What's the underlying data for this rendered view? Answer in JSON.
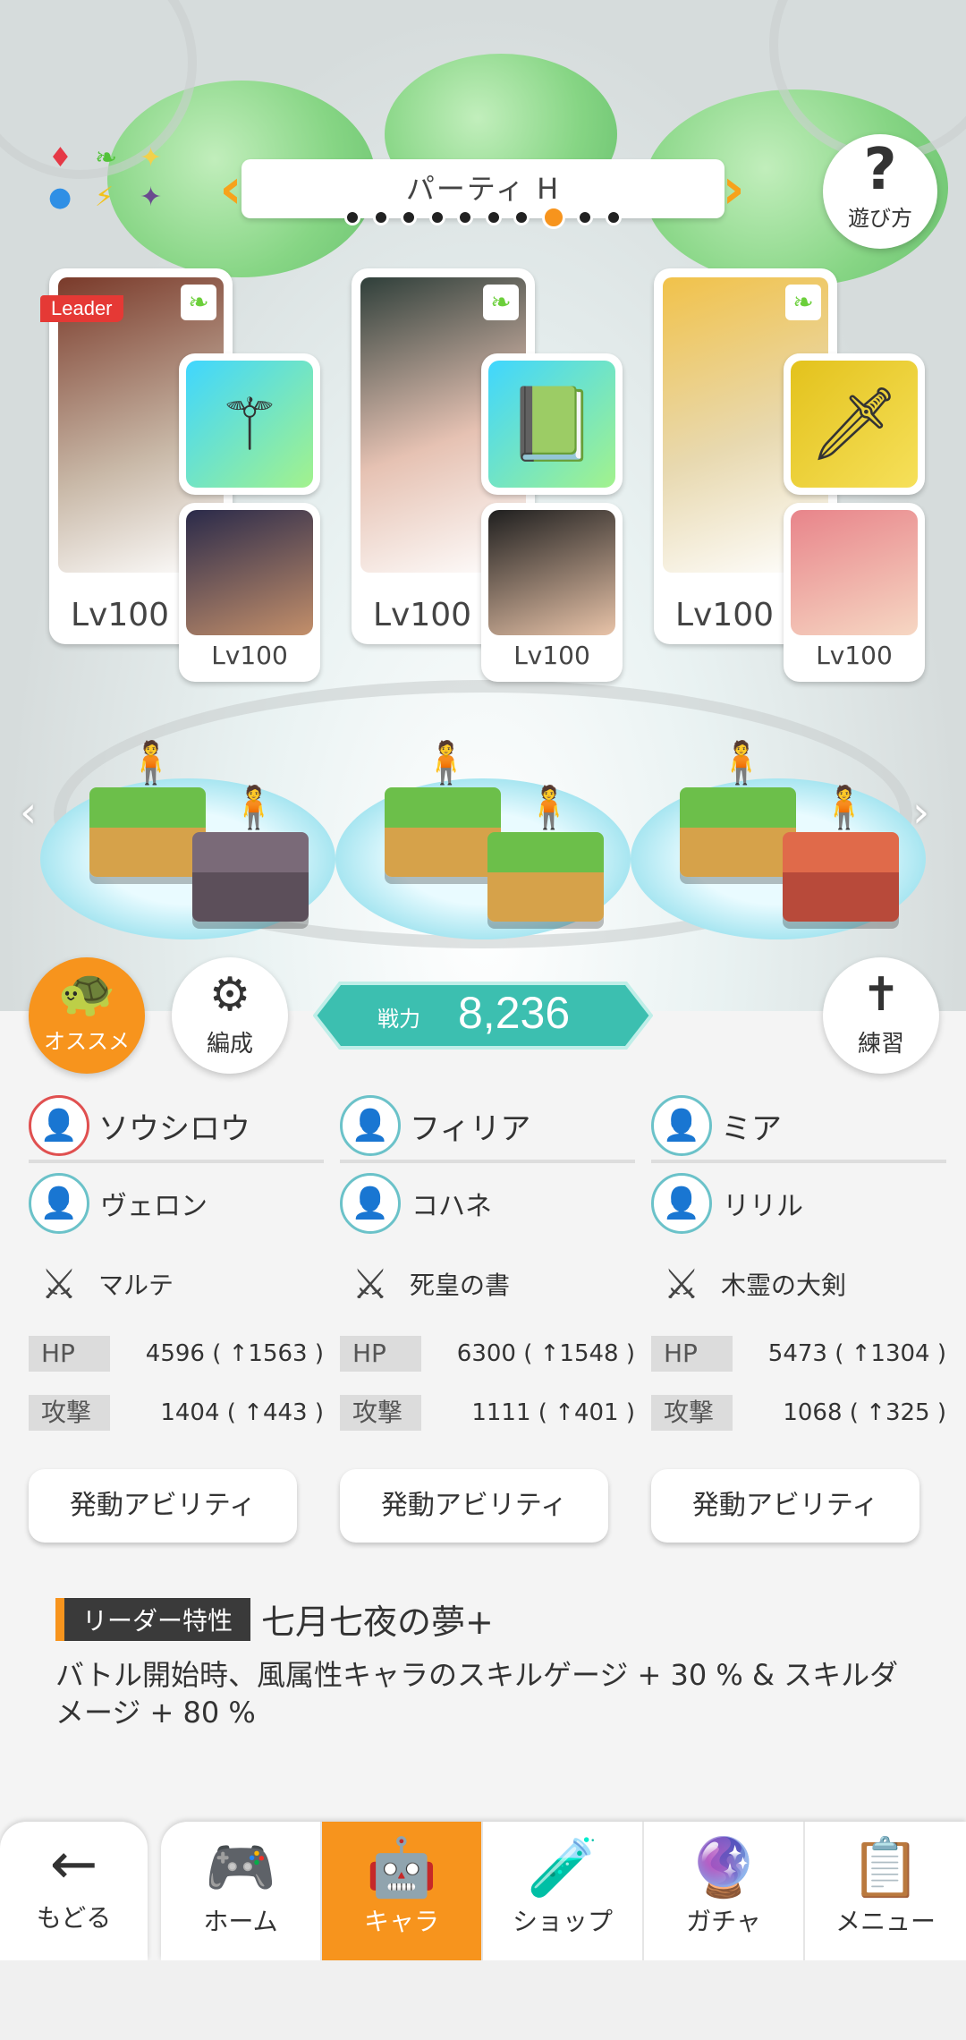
{
  "header": {
    "party_title": "パーティ H",
    "page_count": 10,
    "active_page_index": 7,
    "help_label": "遊び方",
    "prev_icon": "chevron-left-icon",
    "next_icon": "chevron-right-icon"
  },
  "characters": [
    {
      "main_level": "Lv100",
      "sub_level": "Lv100",
      "leader_tag": "Leader"
    },
    {
      "main_level": "Lv100",
      "sub_level": "Lv100"
    },
    {
      "main_level": "Lv100",
      "sub_level": "Lv100"
    }
  ],
  "actions": {
    "recommend_label": "オススメ",
    "formation_label": "編成",
    "practice_label": "練習",
    "power_label": "戦力",
    "power_value": "8,236"
  },
  "columns": [
    {
      "main_name": "ソウシロウ",
      "sub_name": "ヴェロン",
      "weapon": "マルテ",
      "hp_label": "HP",
      "hp_value": "4596 ( ↑1563 )",
      "atk_label": "攻撃",
      "atk_value": "1404 ( ↑443 )",
      "ability_label": "発動アビリティ"
    },
    {
      "main_name": "フィリア",
      "sub_name": "コハネ",
      "weapon": "死皇の書",
      "hp_label": "HP",
      "hp_value": "6300 ( ↑1548 )",
      "atk_label": "攻撃",
      "atk_value": "1111 ( ↑401 )",
      "ability_label": "発動アビリティ"
    },
    {
      "main_name": "ミア",
      "sub_name": "リリル",
      "weapon": "木霊の大剣",
      "hp_label": "HP",
      "hp_value": "5473 ( ↑1304 )",
      "atk_label": "攻撃",
      "atk_value": "1068 ( ↑325 )",
      "ability_label": "発動アビリティ"
    }
  ],
  "leader_skill": {
    "tag": "リーダー特性",
    "name": "七月七夜の夢+",
    "description": "バトル開始時、風属性キャラのスキルゲージ + 30 % & スキルダメージ + 80 %"
  },
  "nav": {
    "back_label": "もどる",
    "tabs": [
      {
        "label": "ホーム",
        "icon": "home-icon"
      },
      {
        "label": "キャラ",
        "icon": "character-icon"
      },
      {
        "label": "ショップ",
        "icon": "shop-icon"
      },
      {
        "label": "ガチャ",
        "icon": "gacha-icon"
      },
      {
        "label": "メニュー",
        "icon": "menu-icon"
      }
    ],
    "active_tab_index": 1
  },
  "colors": {
    "accent": "#f7941d",
    "power": "#3cbfb0",
    "leader": "#e53935"
  }
}
